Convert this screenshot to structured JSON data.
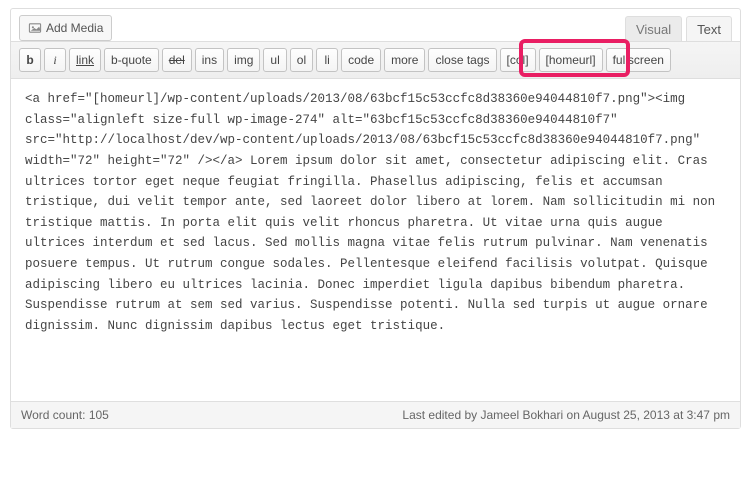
{
  "top": {
    "add_media_label": "Add Media",
    "tab_visual": "Visual",
    "tab_text": "Text"
  },
  "toolbar": {
    "b": "b",
    "i": "i",
    "link": "link",
    "bquote": "b-quote",
    "del": "del",
    "ins": "ins",
    "img": "img",
    "ul": "ul",
    "ol": "ol",
    "li": "li",
    "code": "code",
    "more": "more",
    "close": "close tags",
    "col": "[col]",
    "homeurl": "[homeurl]",
    "fullscreen": "fullscreen"
  },
  "editor": {
    "content": "<a href=\"[homeurl]/wp-content/uploads/2013/08/63bcf15c53ccfc8d38360e94044810f7.png\"><img class=\"alignleft size-full wp-image-274\" alt=\"63bcf15c53ccfc8d38360e94044810f7\" src=\"http://localhost/dev/wp-content/uploads/2013/08/63bcf15c53ccfc8d38360e94044810f7.png\" width=\"72\" height=\"72\" /></a> Lorem ipsum dolor sit amet, consectetur adipiscing elit. Cras ultrices tortor eget neque feugiat fringilla. Phasellus adipiscing, felis et accumsan tristique, dui velit tempor ante, sed laoreet dolor libero at lorem. Nam sollicitudin mi non tristique mattis. In porta elit quis velit rhoncus pharetra. Ut vitae urna quis augue ultrices interdum et sed lacus. Sed mollis magna vitae felis rutrum pulvinar. Nam venenatis posuere tempus. Ut rutrum congue sodales. Pellentesque eleifend facilisis volutpat. Quisque adipiscing libero eu ultrices lacinia. Donec imperdiet ligula dapibus bibendum pharetra. Suspendisse rutrum at sem sed varius. Suspendisse potenti. Nulla sed turpis ut augue ornare dignissim. Nunc dignissim dapibus lectus eget tristique."
  },
  "status": {
    "word_count_label": "Word count: ",
    "word_count_value": "105",
    "last_edited_prefix": "Last edited by ",
    "last_edited_author": "Jameel Bokhari",
    "last_edited_on": " on ",
    "last_edited_datetime": "August 25, 2013 at 3:47 pm"
  }
}
